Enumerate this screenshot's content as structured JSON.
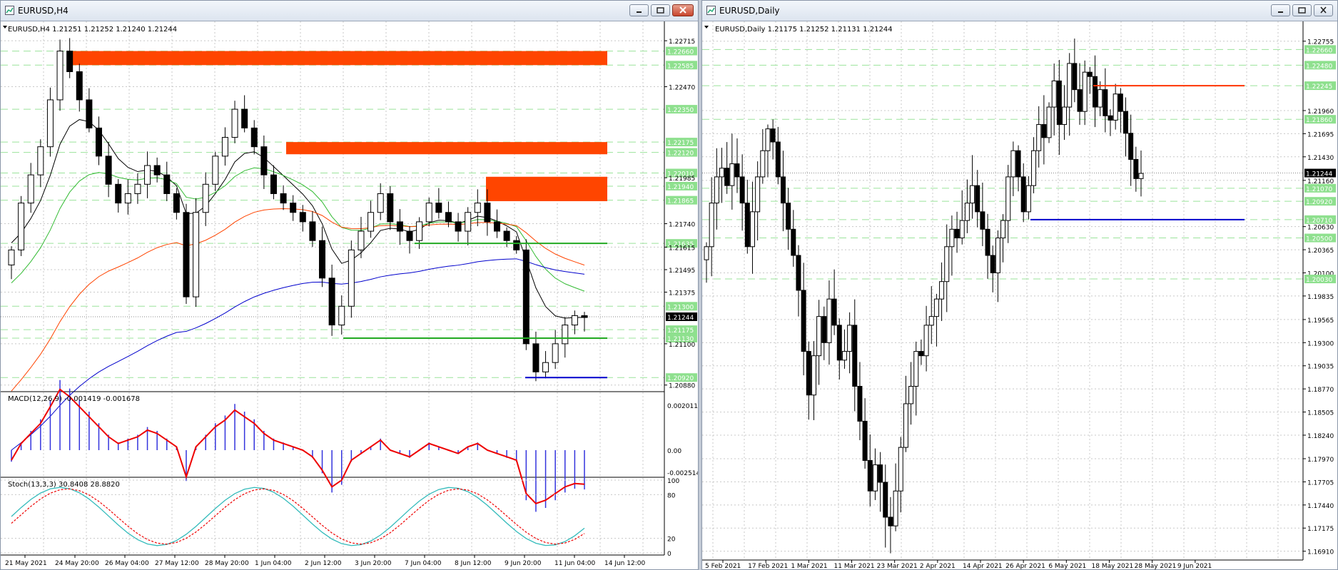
{
  "left_window": {
    "title": "EURUSD,H4",
    "chart_header": "EURUSD,H4  1.21251 1.21252 1.21240 1.21244",
    "price_labels": [
      {
        "text": "1.22715",
        "y": 1.22715,
        "style": "plain"
      },
      {
        "text": "1.22660",
        "y": 1.2266,
        "style": "green"
      },
      {
        "text": "1.22585",
        "y": 1.22585,
        "style": "green"
      },
      {
        "text": "1.22470",
        "y": 1.2247,
        "style": "plain"
      },
      {
        "text": "1.22350",
        "y": 1.2235,
        "style": "green"
      },
      {
        "text": "1.22175",
        "y": 1.22175,
        "style": "green"
      },
      {
        "text": "1.22120",
        "y": 1.2212,
        "style": "green"
      },
      {
        "text": "1.22010",
        "y": 1.2201,
        "style": "green"
      },
      {
        "text": "1.21985",
        "y": 1.21985,
        "style": "plain"
      },
      {
        "text": "1.21940",
        "y": 1.2194,
        "style": "green"
      },
      {
        "text": "1.21865",
        "y": 1.21865,
        "style": "green"
      },
      {
        "text": "1.21740",
        "y": 1.2174,
        "style": "plain"
      },
      {
        "text": "1.21635",
        "y": 1.21635,
        "style": "green"
      },
      {
        "text": "1.21615",
        "y": 1.21615,
        "style": "plain"
      },
      {
        "text": "1.21495",
        "y": 1.21495,
        "style": "plain"
      },
      {
        "text": "1.21375",
        "y": 1.21375,
        "style": "plain"
      },
      {
        "text": "1.21300",
        "y": 1.213,
        "style": "green"
      },
      {
        "text": "1.21244",
        "y": 1.21244,
        "style": "current"
      },
      {
        "text": "1.21175",
        "y": 1.21175,
        "style": "green"
      },
      {
        "text": "1.21130",
        "y": 1.2113,
        "style": "green"
      },
      {
        "text": "1.21100",
        "y": 1.211,
        "style": "plain"
      },
      {
        "text": "1.20920",
        "y": 1.2092,
        "style": "green"
      },
      {
        "text": "1.20880",
        "y": 1.2088,
        "style": "plain"
      }
    ],
    "macd_label": "MACD(12,26,9) -0.001419 -0.001678",
    "macd_scale": [
      "0.002011",
      "0.00",
      "-0.002514"
    ],
    "stoch_label": "Stoch(13,3,3) 30.8408 28.8820",
    "stoch_scale": [
      "100",
      "80",
      "20",
      "0"
    ],
    "time_labels": [
      "21 May 2021",
      "24 May 20:00",
      "26 May 04:00",
      "27 May 12:00",
      "28 May 20:00",
      "1 Jun 04:00",
      "2 Jun 12:00",
      "3 Jun 20:00",
      "7 Jun 04:00",
      "8 Jun 12:00",
      "9 Jun 20:00",
      "11 Jun 04:00",
      "14 Jun 12:00"
    ]
  },
  "right_window": {
    "title": "EURUSD,Daily",
    "chart_header": "EURUSD,Daily  1.21175 1.21252 1.21131 1.21244",
    "price_labels": [
      {
        "text": "1.22755",
        "y": 1.22755,
        "style": "plain"
      },
      {
        "text": "1.22660",
        "y": 1.2266,
        "style": "green"
      },
      {
        "text": "1.22480",
        "y": 1.2248,
        "style": "green"
      },
      {
        "text": "1.22245",
        "y": 1.22245,
        "style": "green"
      },
      {
        "text": "1.21960",
        "y": 1.2196,
        "style": "plain"
      },
      {
        "text": "1.21860",
        "y": 1.2186,
        "style": "green"
      },
      {
        "text": "1.21695",
        "y": 1.21695,
        "style": "plain"
      },
      {
        "text": "1.21430",
        "y": 1.2143,
        "style": "plain"
      },
      {
        "text": "1.21244",
        "y": 1.21244,
        "style": "current"
      },
      {
        "text": "1.21160",
        "y": 1.2116,
        "style": "plain"
      },
      {
        "text": "1.21070",
        "y": 1.2107,
        "style": "green"
      },
      {
        "text": "1.20920",
        "y": 1.2092,
        "style": "green"
      },
      {
        "text": "1.20710",
        "y": 1.2071,
        "style": "green"
      },
      {
        "text": "1.20630",
        "y": 1.2063,
        "style": "plain"
      },
      {
        "text": "1.20500",
        "y": 1.205,
        "style": "green"
      },
      {
        "text": "1.20365",
        "y": 1.20365,
        "style": "plain"
      },
      {
        "text": "1.20100",
        "y": 1.201,
        "style": "plain"
      },
      {
        "text": "1.20030",
        "y": 1.2003,
        "style": "green"
      },
      {
        "text": "1.19835",
        "y": 1.19835,
        "style": "plain"
      },
      {
        "text": "1.19565",
        "y": 1.19565,
        "style": "plain"
      },
      {
        "text": "1.19300",
        "y": 1.193,
        "style": "plain"
      },
      {
        "text": "1.19035",
        "y": 1.19035,
        "style": "plain"
      },
      {
        "text": "1.18770",
        "y": 1.1877,
        "style": "plain"
      },
      {
        "text": "1.18505",
        "y": 1.18505,
        "style": "plain"
      },
      {
        "text": "1.18240",
        "y": 1.1824,
        "style": "plain"
      },
      {
        "text": "1.17970",
        "y": 1.1797,
        "style": "plain"
      },
      {
        "text": "1.17705",
        "y": 1.17705,
        "style": "plain"
      },
      {
        "text": "1.17440",
        "y": 1.1744,
        "style": "plain"
      },
      {
        "text": "1.17175",
        "y": 1.17175,
        "style": "plain"
      },
      {
        "text": "1.16910",
        "y": 1.1691,
        "style": "plain"
      }
    ],
    "time_labels": [
      "5 Feb 2021",
      "17 Feb 2021",
      "1 Mar 2021",
      "11 Mar 2021",
      "23 Mar 2021",
      "2 Apr 2021",
      "14 Apr 2021",
      "26 Apr 2021",
      "6 May 2021",
      "18 May 2021",
      "28 May 2021",
      "9 Jun 2021"
    ]
  },
  "colors": {
    "zone": "#ff4500",
    "support_line": "#22aa22",
    "low_line": "#0000cc",
    "red_line": "#ff3300",
    "ma_black": "#000000",
    "ma_green": "#33bb33",
    "ma_red": "#ff4400",
    "ma_blue": "#0000cc",
    "grid_green": "#9be39b",
    "grid_gray": "#c8c8c8",
    "macd_hist": "#3333dd",
    "macd_signal": "#ee0000",
    "stoch_main": "#33bbbb",
    "stoch_signal": "#ee0000"
  }
}
